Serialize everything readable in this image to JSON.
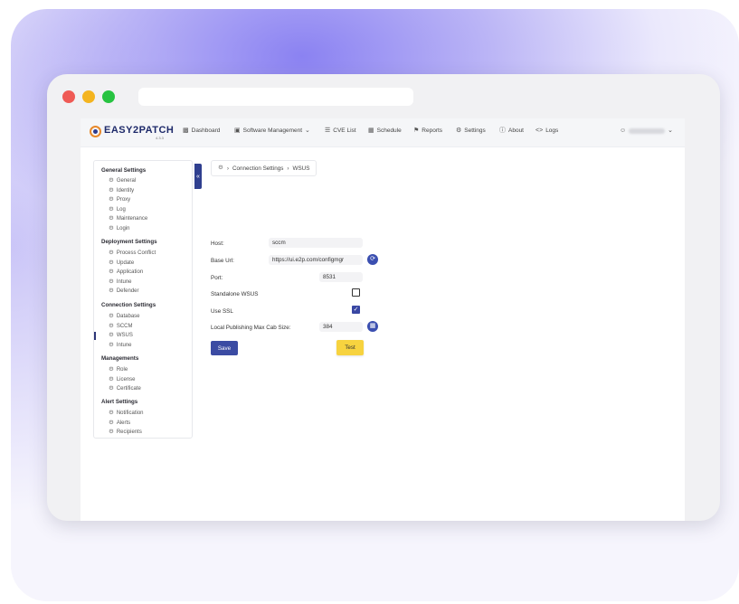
{
  "app": {
    "brand": "EASY2PATCH",
    "version": "4.3.3"
  },
  "nav": {
    "items": [
      {
        "label": "Dashboard",
        "icon": "bar-chart-icon"
      },
      {
        "label": "Software Management",
        "icon": "monitor-icon",
        "dropdown": true
      },
      {
        "label": "CVE List",
        "icon": "list-icon"
      },
      {
        "label": "Schedule",
        "icon": "calendar-icon"
      },
      {
        "label": "Reports",
        "icon": "flag-icon"
      },
      {
        "label": "Settings",
        "icon": "gear-icon"
      },
      {
        "label": "About",
        "icon": "info-icon"
      },
      {
        "label": "Logs",
        "icon": "code-icon"
      }
    ]
  },
  "sidebar": {
    "sections": [
      {
        "title": "General Settings",
        "items": [
          "General",
          "Identity",
          "Proxy",
          "Log",
          "Maintenance",
          "Login"
        ]
      },
      {
        "title": "Deployment Settings",
        "items": [
          "Process Conflict",
          "Update",
          "Application",
          "Intune",
          "Defender"
        ]
      },
      {
        "title": "Connection Settings",
        "items": [
          "Database",
          "SCCM",
          "WSUS",
          "Intune"
        ]
      },
      {
        "title": "Managements",
        "items": [
          "Role",
          "License",
          "Certificate"
        ]
      },
      {
        "title": "Alert Settings",
        "items": [
          "Notification",
          "Alerts",
          "Recipients"
        ]
      }
    ],
    "active": "WSUS",
    "collapse_label": "«"
  },
  "breadcrumb": {
    "parts": [
      "Connection Settings",
      "WSUS"
    ]
  },
  "form": {
    "host": {
      "label": "Host:",
      "value": "sccm"
    },
    "base_url": {
      "label": "Base Url:",
      "value": "https://ui.e2p.com/configmgr"
    },
    "port": {
      "label": "Port:",
      "value": "8531"
    },
    "standalone_wsus": {
      "label": "Standalone WSUS",
      "checked": false
    },
    "use_ssl": {
      "label": "Use SSL",
      "checked": true
    },
    "max_cab_size": {
      "label": "Local Publishing Max Cab Size:",
      "value": "384"
    }
  },
  "buttons": {
    "save": "Save",
    "test": "Test"
  }
}
